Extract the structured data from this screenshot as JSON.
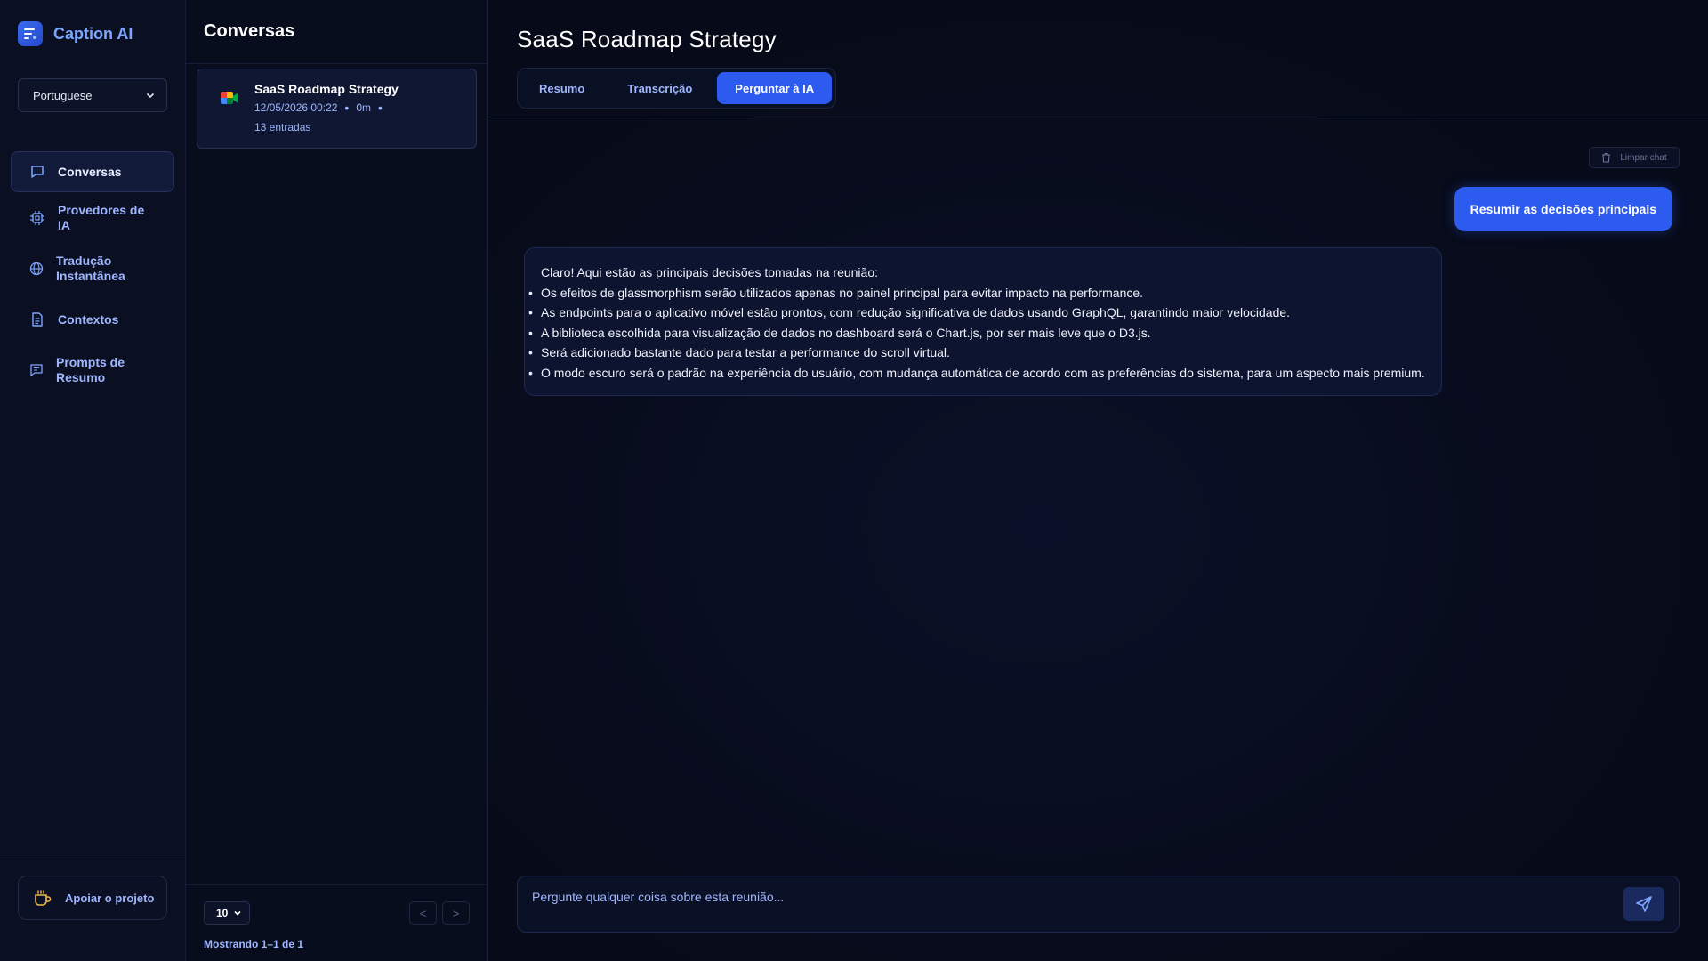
{
  "app": {
    "name": "Caption AI"
  },
  "language": {
    "selected": "Portuguese"
  },
  "nav": {
    "items": [
      {
        "label": "Conversas",
        "icon": "chat-bubble-icon",
        "active": true
      },
      {
        "label": "Provedores de IA",
        "icon": "cpu-chip-icon"
      },
      {
        "label": "Tradução Instantânea",
        "icon": "globe-icon"
      },
      {
        "label": "Contextos",
        "icon": "document-icon"
      },
      {
        "label": "Prompts de Resumo",
        "icon": "message-lines-icon"
      }
    ]
  },
  "support": {
    "label": "Apoiar o projeto",
    "icon": "coffee-cup-icon"
  },
  "conversations": {
    "title": "Conversas",
    "items": [
      {
        "title": "SaaS Roadmap Strategy",
        "date": "12/05/2026 00:22",
        "duration": "0m",
        "dot": "•",
        "entries": "13 entradas",
        "icon": "google-meet-icon"
      }
    ],
    "page_size": "10",
    "prev": "<",
    "next": ">",
    "showing": "Mostrando 1–1 de 1"
  },
  "main": {
    "title": "SaaS Roadmap Strategy",
    "tabs": [
      {
        "label": "Resumo"
      },
      {
        "label": "Transcrição"
      },
      {
        "label": "Perguntar à IA",
        "active": true
      }
    ],
    "clear_chat": "Limpar chat",
    "user_message": "Resumir as decisões principais",
    "ai_message": {
      "intro": "Claro! Aqui estão as principais decisões tomadas na reunião:",
      "bullets": [
        "Os efeitos de glassmorphism serão utilizados apenas no painel principal para evitar impacto na performance.",
        "As endpoints para o aplicativo móvel estão prontos, com redução significativa de dados usando GraphQL, garantindo maior velocidade.",
        "A biblioteca escolhida para visualização de dados no dashboard será o Chart.js, por ser mais leve que o D3.js.",
        "Será adicionado bastante dado para testar a performance do scroll virtual.",
        "O modo escuro será o padrão na experiência do usuário, com mudança automática de acordo com as preferências do sistema, para um aspecto mais premium."
      ]
    },
    "input_placeholder": "Pergunte qualquer coisa sobre esta reunião..."
  },
  "colors": {
    "accent": "#2d5bf0",
    "link": "#9fb6ff",
    "background": "#070b19"
  }
}
